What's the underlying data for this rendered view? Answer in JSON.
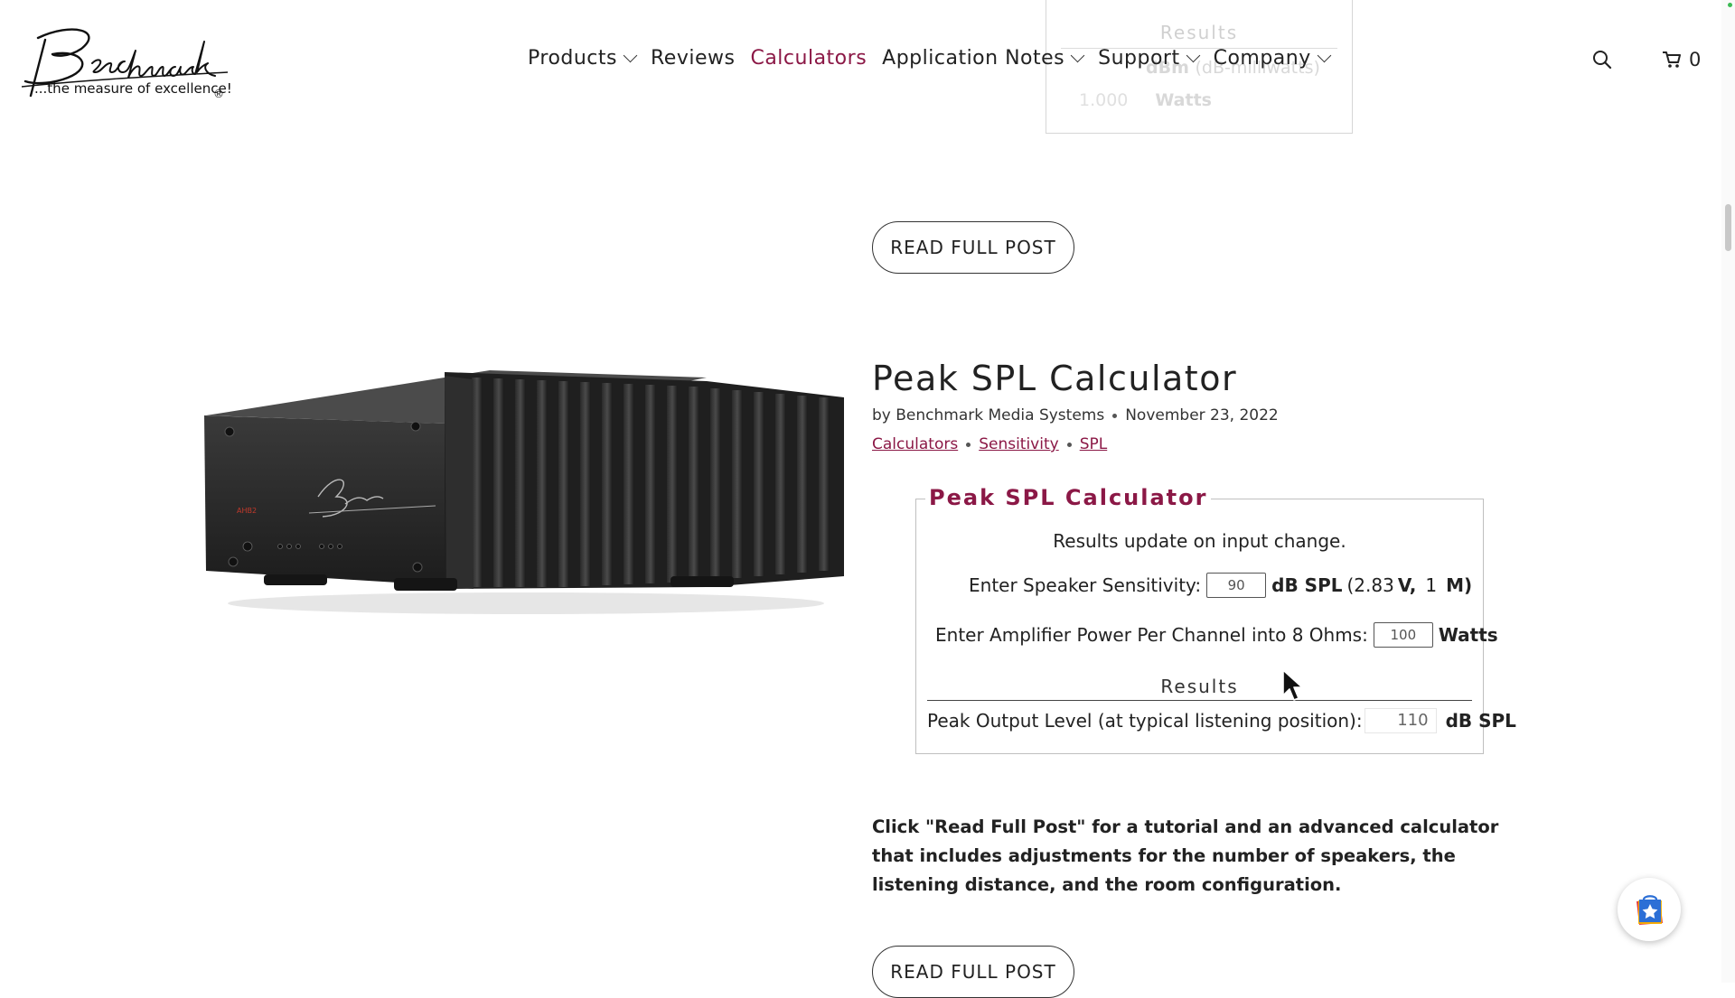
{
  "brand": {
    "logo_script": "Benchmark",
    "tagline": "...the measure of excellence!",
    "reg": "®",
    "accent": "#8b1846"
  },
  "nav": {
    "items": [
      {
        "label": "Products",
        "has_menu": true
      },
      {
        "label": "Reviews",
        "has_menu": false
      },
      {
        "label": "Calculators",
        "has_menu": false,
        "active": true
      },
      {
        "label": "Application Notes",
        "has_menu": true
      },
      {
        "label": "Support",
        "has_menu": true
      },
      {
        "label": "Company",
        "has_menu": true
      }
    ],
    "cart_count": "0",
    "search_icon": "search-icon",
    "cart_icon": "cart-icon"
  },
  "prev_post": {
    "results_label": "Results",
    "row1_value": "dBm",
    "row1_unit": "(dB-milliwatts)",
    "row2_value": "1.000",
    "row2_unit": "Watts",
    "read_more": "READ FULL POST"
  },
  "post": {
    "title": "Peak SPL Calculator",
    "author": "by Benchmark Media Systems",
    "date": "November 23, 2022",
    "tags": [
      "Calculators",
      "Sensitivity",
      "SPL"
    ],
    "calculator": {
      "legend": "Peak SPL Calculator",
      "note": "Results update on input change.",
      "sensitivity_label": "Enter Speaker Sensitivity:",
      "sensitivity_value": "90",
      "sensitivity_unit": "dB SPL",
      "sensitivity_ref_open": "(2.83",
      "sensitivity_ref_v": "V,",
      "sensitivity_ref_num": "1",
      "sensitivity_ref_m": "M)",
      "power_label": "Enter Amplifier Power Per Channel into 8 Ohms:",
      "power_value": "100",
      "power_unit": "Watts",
      "results_label": "Results",
      "output_label": "Peak Output Level (at typical listening position):",
      "output_value": "110",
      "output_unit": "dB SPL"
    },
    "blurb": "Click \"Read Full Post\" for a tutorial and an advanced calculator that includes adjustments for the number of speakers, the listening distance, and the room configuration.",
    "read_more": "READ FULL POST"
  }
}
